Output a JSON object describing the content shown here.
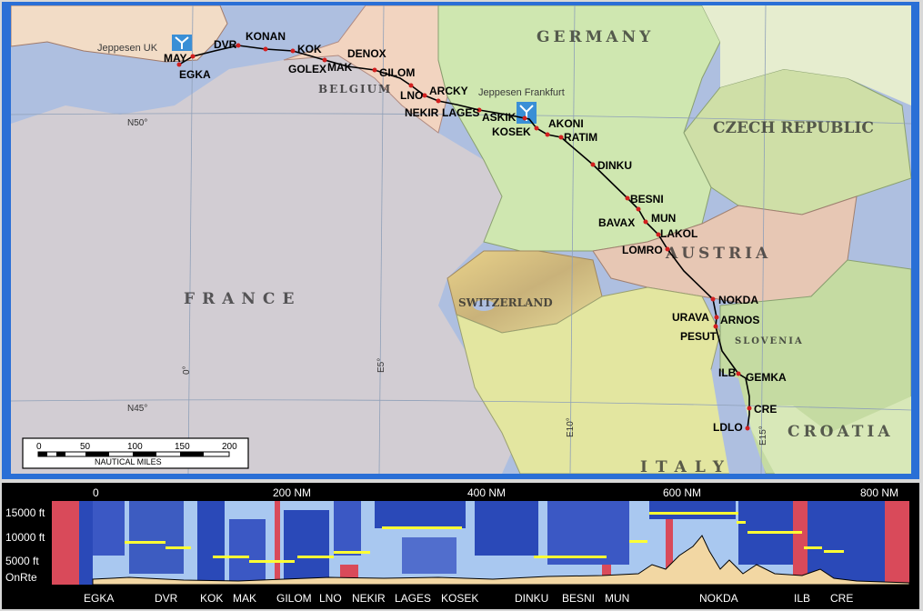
{
  "map": {
    "countries": [
      "GERMANY",
      "CZECH REPUBLIC",
      "BELGIUM",
      "FRANCE",
      "SWITZERLAND",
      "AUSTRIA",
      "SLOVENIA",
      "CROATIA",
      "ITALY"
    ],
    "grid_labels": [
      "N50°",
      "N45°",
      "0°",
      "E5°",
      "E10°",
      "E15°"
    ],
    "airports": [
      {
        "name": "Jeppesen UK",
        "icon": "airport-icon"
      },
      {
        "name": "Jeppesen Frankfurt",
        "icon": "airport-icon"
      }
    ],
    "waypoints": [
      "MAY",
      "EGKA",
      "DVR",
      "KONAN",
      "KOK",
      "DENOX",
      "GOLEX",
      "MAK",
      "GILOM",
      "ARCKY",
      "LNO",
      "NEKIR",
      "LAGES",
      "ASKIK",
      "AKONI",
      "KOSEK",
      "RATIM",
      "DINKU",
      "BESNI",
      "MUN",
      "BAVAX",
      "LAKOL",
      "LOMRO",
      "NOKDA",
      "URAVA",
      "ARNOS",
      "PESUT",
      "ILB",
      "GEMKA",
      "CRE",
      "LDLO"
    ],
    "route_color": "#000000",
    "waypoint_color": "#d21f1f",
    "scale": {
      "ticks": [
        "0",
        "50",
        "100",
        "150",
        "200"
      ],
      "label": "NAUTICAL MILES"
    }
  },
  "profile": {
    "distance_labels": [
      "0",
      "200 NM",
      "400 NM",
      "600 NM",
      "800 NM"
    ],
    "altitude_labels": [
      "15000 ft",
      "10000 ft",
      "5000 ft",
      "OnRte"
    ],
    "waypoints": [
      "EGKA",
      "DVR",
      "KOK",
      "MAK",
      "GILOM",
      "LNO",
      "NEKIR",
      "LAGES",
      "KOSEK",
      "DINKU",
      "BESNI",
      "MUN",
      "NOKDA",
      "ILB",
      "CRE"
    ],
    "colors": {
      "background": "#000000",
      "sky_light": "#a9c8f0",
      "sky_dark": "#2a49b8",
      "restricted": "#d94a5a",
      "terrain": "#f2d7a3",
      "altitude_bars": "#ffff33"
    }
  }
}
